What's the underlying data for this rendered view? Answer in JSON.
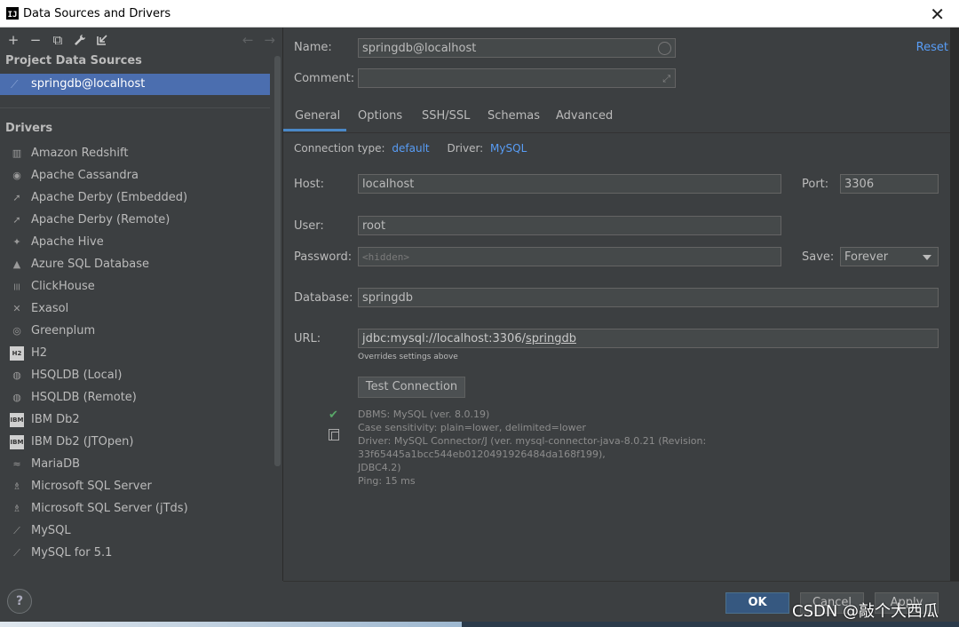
{
  "window": {
    "title": "Data Sources and Drivers"
  },
  "toolbar": {
    "add": "+",
    "remove": "−",
    "duplicate": "⧉",
    "settings": "🔧",
    "import": "⇲",
    "back": "←",
    "forward": "→"
  },
  "project_sources": {
    "title": "Project Data Sources",
    "items": [
      {
        "label": "springdb@localhost"
      }
    ]
  },
  "drivers": {
    "title": "Drivers",
    "items": [
      {
        "label": "Amazon Redshift",
        "icon": "redshift-icon"
      },
      {
        "label": "Apache Cassandra",
        "icon": "cassandra-icon"
      },
      {
        "label": "Apache Derby (Embedded)",
        "icon": "derby-icon"
      },
      {
        "label": "Apache Derby (Remote)",
        "icon": "derby-icon"
      },
      {
        "label": "Apache Hive",
        "icon": "hive-icon"
      },
      {
        "label": "Azure SQL Database",
        "icon": "azure-icon"
      },
      {
        "label": "ClickHouse",
        "icon": "clickhouse-icon"
      },
      {
        "label": "Exasol",
        "icon": "exasol-icon"
      },
      {
        "label": "Greenplum",
        "icon": "greenplum-icon"
      },
      {
        "label": "H2",
        "icon": "h2-icon"
      },
      {
        "label": "HSQLDB (Local)",
        "icon": "hsqldb-icon"
      },
      {
        "label": "HSQLDB (Remote)",
        "icon": "hsqldb-icon"
      },
      {
        "label": "IBM Db2",
        "icon": "ibm-icon"
      },
      {
        "label": "IBM Db2 (JTOpen)",
        "icon": "ibm-icon"
      },
      {
        "label": "MariaDB",
        "icon": "mariadb-icon"
      },
      {
        "label": "Microsoft SQL Server",
        "icon": "mssql-icon"
      },
      {
        "label": "Microsoft SQL Server (jTds)",
        "icon": "mssql-icon"
      },
      {
        "label": "MySQL",
        "icon": "mysql-icon"
      },
      {
        "label": "MySQL for 5.1",
        "icon": "mysql-icon"
      }
    ]
  },
  "form": {
    "name_label": "Name:",
    "name_value": "springdb@localhost",
    "comment_label": "Comment:",
    "comment_value": "",
    "reset": "Reset",
    "tabs": [
      "General",
      "Options",
      "SSH/SSL",
      "Schemas",
      "Advanced"
    ],
    "connection_type_label": "Connection type:",
    "connection_type_value": "default",
    "driver_label": "Driver:",
    "driver_value": "MySQL",
    "host_label": "Host:",
    "host_value": "localhost",
    "port_label": "Port:",
    "port_value": "3306",
    "user_label": "User:",
    "user_value": "root",
    "password_label": "Password:",
    "password_placeholder": "<hidden>",
    "save_label": "Save:",
    "save_value": "Forever",
    "database_label": "Database:",
    "database_value": "springdb",
    "url_label": "URL:",
    "url_prefix": "jdbc:mysql://localhost:3306/",
    "url_db": "springdb",
    "url_note": "Overrides settings above",
    "test_connection": "Test Connection"
  },
  "status": {
    "lines": [
      "DBMS: MySQL (ver. 8.0.19)",
      "Case sensitivity: plain=lower, delimited=lower",
      "Driver: MySQL Connector/J (ver. mysql-connector-java-8.0.21 (Revision: 33f65445a1bcc544eb0120491926484da168f199),",
      "JDBC4.2)",
      "Ping: 15 ms"
    ]
  },
  "buttons": {
    "ok": "OK",
    "cancel": "Cancel",
    "apply": "Apply",
    "help": "?"
  },
  "watermark": "CSDN @敲个大西瓜",
  "colors": {
    "accent": "#4b6eaf",
    "link": "#589df6",
    "ok": "#365880"
  }
}
